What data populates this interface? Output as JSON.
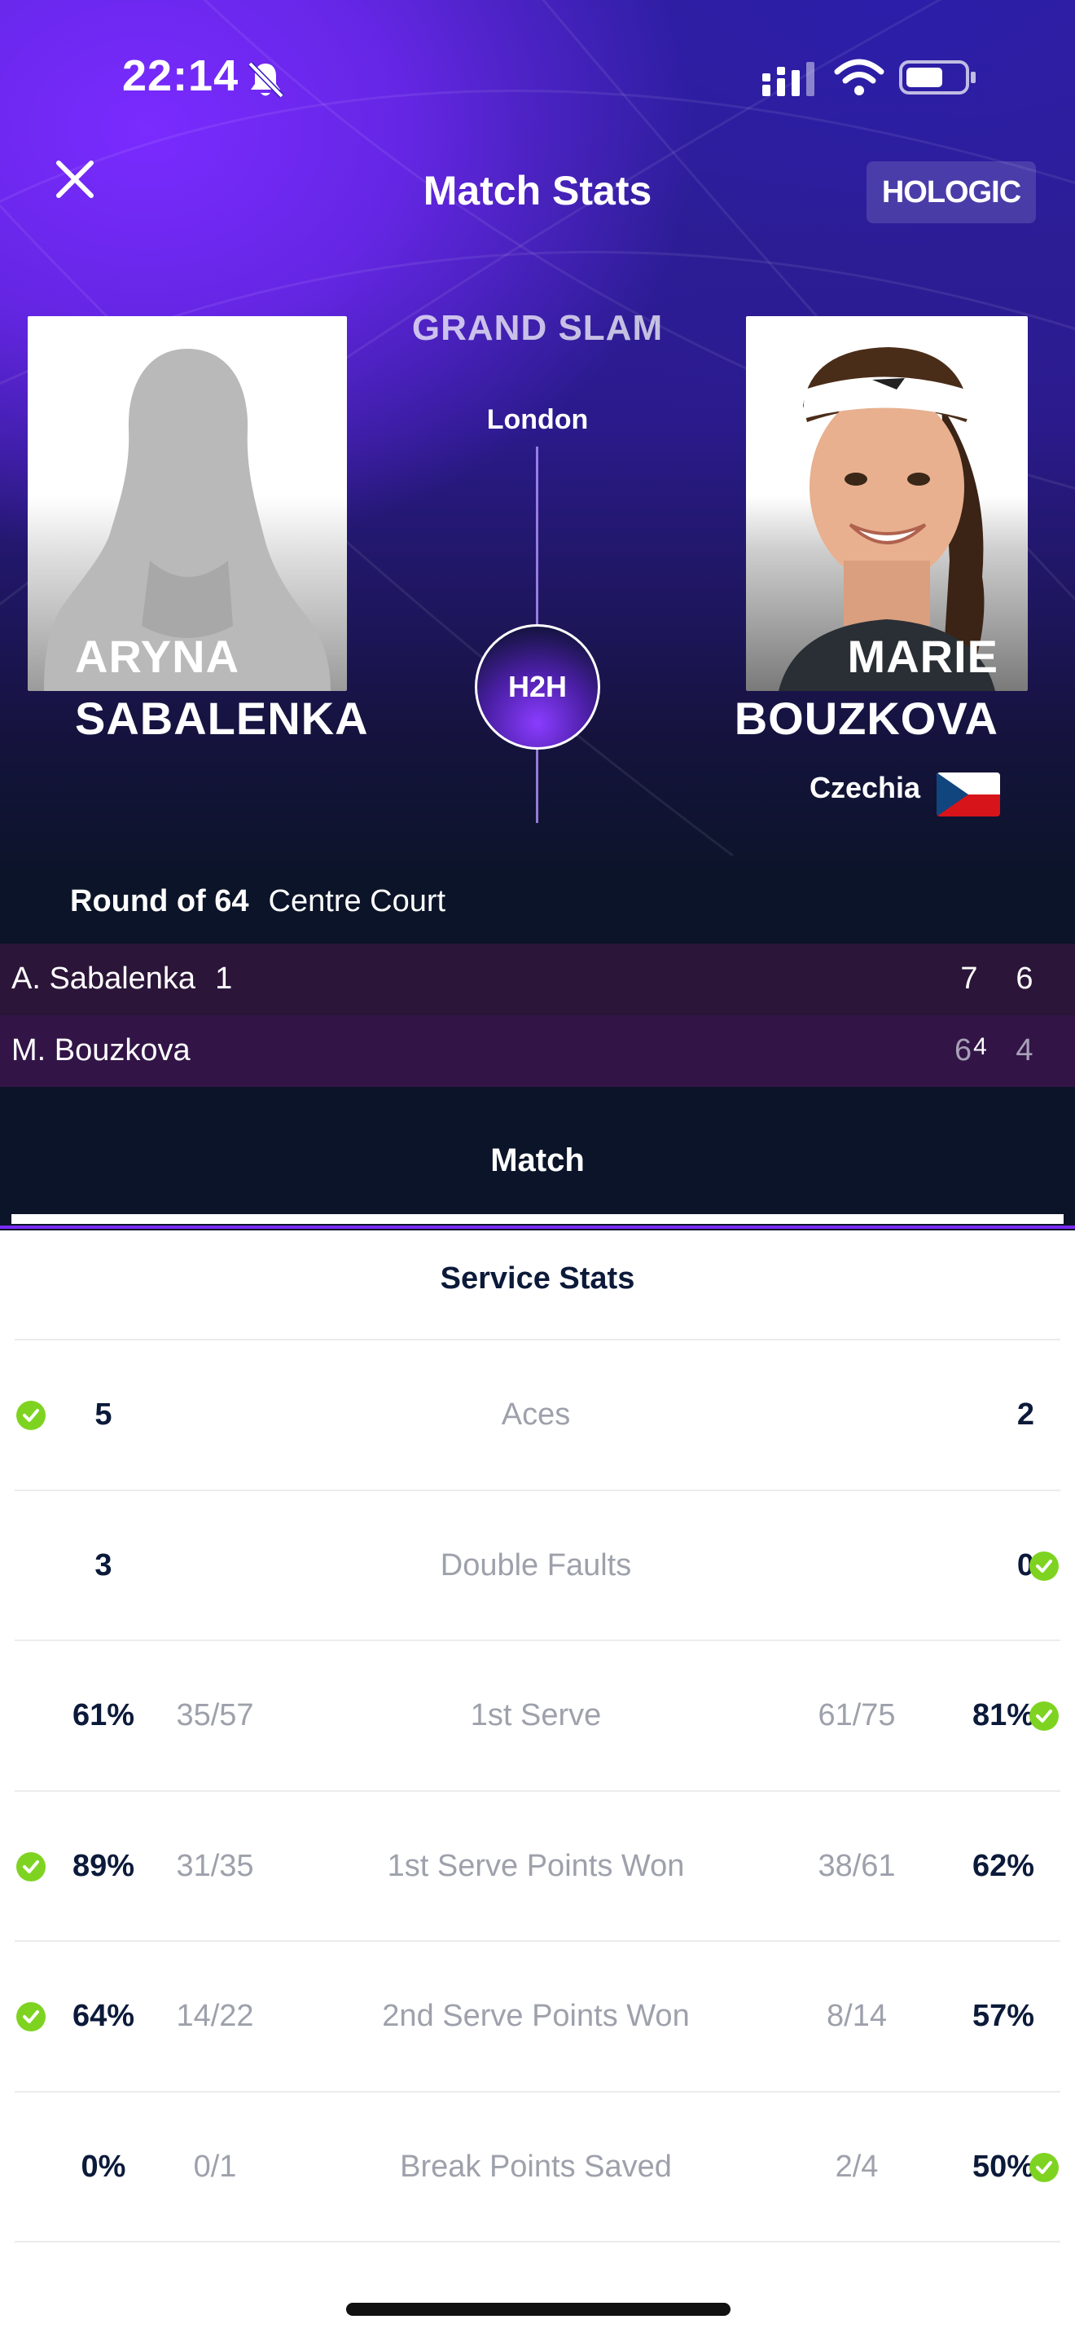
{
  "status_bar": {
    "time": "22:14",
    "icons": [
      "bell-muted-icon",
      "signal-icon",
      "wifi-icon",
      "battery-icon"
    ]
  },
  "header": {
    "title": "Match Stats",
    "sponsor": "HOLOGIC",
    "close_icon": "close-icon"
  },
  "match": {
    "tournament": "GRAND SLAM",
    "city": "London",
    "h2h_label": "H2H",
    "round": "Round of 64",
    "court": "Centre Court"
  },
  "players": {
    "left": {
      "first": "ARYNA",
      "last": "SABALENKA",
      "photo": "silhouette"
    },
    "right": {
      "first": "MARIE",
      "last": "BOUZKOVA",
      "country": "Czechia",
      "flag": "czech-flag-icon"
    }
  },
  "scoreboard": {
    "rows": [
      {
        "name": "A. Sabalenka",
        "seed": "1",
        "sets": [
          "7",
          "6"
        ],
        "tiebreaks": [
          "",
          ""
        ],
        "winner": true
      },
      {
        "name": "M. Bouzkova",
        "seed": "",
        "sets": [
          "6",
          "4"
        ],
        "tiebreaks": [
          "4",
          ""
        ],
        "winner": false
      }
    ]
  },
  "tabs": {
    "active": "Match"
  },
  "service_stats": {
    "title": "Service Stats",
    "rows": [
      {
        "label": "Aces",
        "left_value": "5",
        "left_fraction": "",
        "right_fraction": "",
        "right_value": "2",
        "leader": "left"
      },
      {
        "label": "Double Faults",
        "left_value": "3",
        "left_fraction": "",
        "right_fraction": "",
        "right_value": "0",
        "leader": "right"
      },
      {
        "label": "1st Serve",
        "left_value": "61%",
        "left_fraction": "35/57",
        "right_fraction": "61/75",
        "right_value": "81%",
        "leader": "right"
      },
      {
        "label": "1st Serve Points Won",
        "left_value": "89%",
        "left_fraction": "31/35",
        "right_fraction": "38/61",
        "right_value": "62%",
        "leader": "left"
      },
      {
        "label": "2nd Serve Points Won",
        "left_value": "64%",
        "left_fraction": "14/22",
        "right_fraction": "8/14",
        "right_value": "57%",
        "leader": "left"
      },
      {
        "label": "Break Points Saved",
        "left_value": "0%",
        "left_fraction": "0/1",
        "right_fraction": "2/4",
        "right_value": "50%",
        "leader": "right"
      }
    ]
  },
  "colors": {
    "accent": "#7a2bff",
    "dark_bg": "#0b1428",
    "check_green": "#7ed321",
    "stat_value": "#0c1a3a",
    "stat_muted": "#9ea1ab"
  }
}
